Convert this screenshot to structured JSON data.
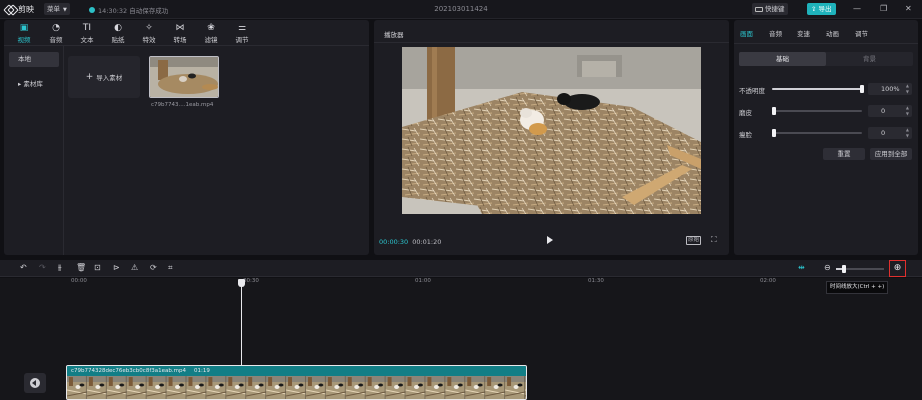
{
  "titlebar": {
    "app_name": "剪映",
    "menu_label": "菜单",
    "save_status": "14:30:32 自动保存成功",
    "project_title": "202103011424",
    "shortcut_label": "快捷键",
    "export_label": "导出"
  },
  "toolbar": {
    "tools": [
      {
        "label": "视频",
        "icon": "video-icon"
      },
      {
        "label": "音频",
        "icon": "audio-icon"
      },
      {
        "label": "文本",
        "icon": "text-icon"
      },
      {
        "label": "贴纸",
        "icon": "sticker-icon"
      },
      {
        "label": "特效",
        "icon": "effects-icon"
      },
      {
        "label": "转场",
        "icon": "transition-icon"
      },
      {
        "label": "滤镜",
        "icon": "filter-icon"
      },
      {
        "label": "调节",
        "icon": "adjust-icon"
      }
    ],
    "active_tool": "视频"
  },
  "media": {
    "nav": [
      {
        "label": "本地"
      },
      {
        "label": "素材库"
      }
    ],
    "import_label": "导入素材",
    "clip_name": "c79b7743....1eab.mp4"
  },
  "player": {
    "title": "播放器",
    "current_time": "00:00:30",
    "total_time": "00:01:20",
    "ratio_label": "原始"
  },
  "properties": {
    "tabs": [
      {
        "label": "画面"
      },
      {
        "label": "音频"
      },
      {
        "label": "变速"
      },
      {
        "label": "动画"
      },
      {
        "label": "调节"
      }
    ],
    "active_tab": "画面",
    "subtabs": [
      {
        "label": "基础"
      },
      {
        "label": "背景"
      }
    ],
    "opacity": {
      "label": "不透明度",
      "value": "100%",
      "level": 1.0
    },
    "smoothing": {
      "label": "磨皮",
      "value": "0",
      "level": 0.0
    },
    "slimming": {
      "label": "瘦脸",
      "value": "0",
      "level": 0.0
    },
    "reset_label": "重置",
    "apply_all_label": "应用到全部"
  },
  "timeline": {
    "ruler_labels": [
      "00:00",
      "00:30",
      "01:00",
      "01:30",
      "02:00"
    ],
    "zoom_tooltip": "时间线放大(Ctrl + +)",
    "zoom_level": 0.15,
    "clip_name": "c79b774328dec76eb3cb0c8f3a1eab.mp4",
    "clip_duration": "01:19"
  },
  "colors": {
    "accent": "#2cc7d0",
    "export_bg": "#1fb2bb",
    "clip_label_bg": "#127e86",
    "highlight_border": "#e0302e"
  }
}
